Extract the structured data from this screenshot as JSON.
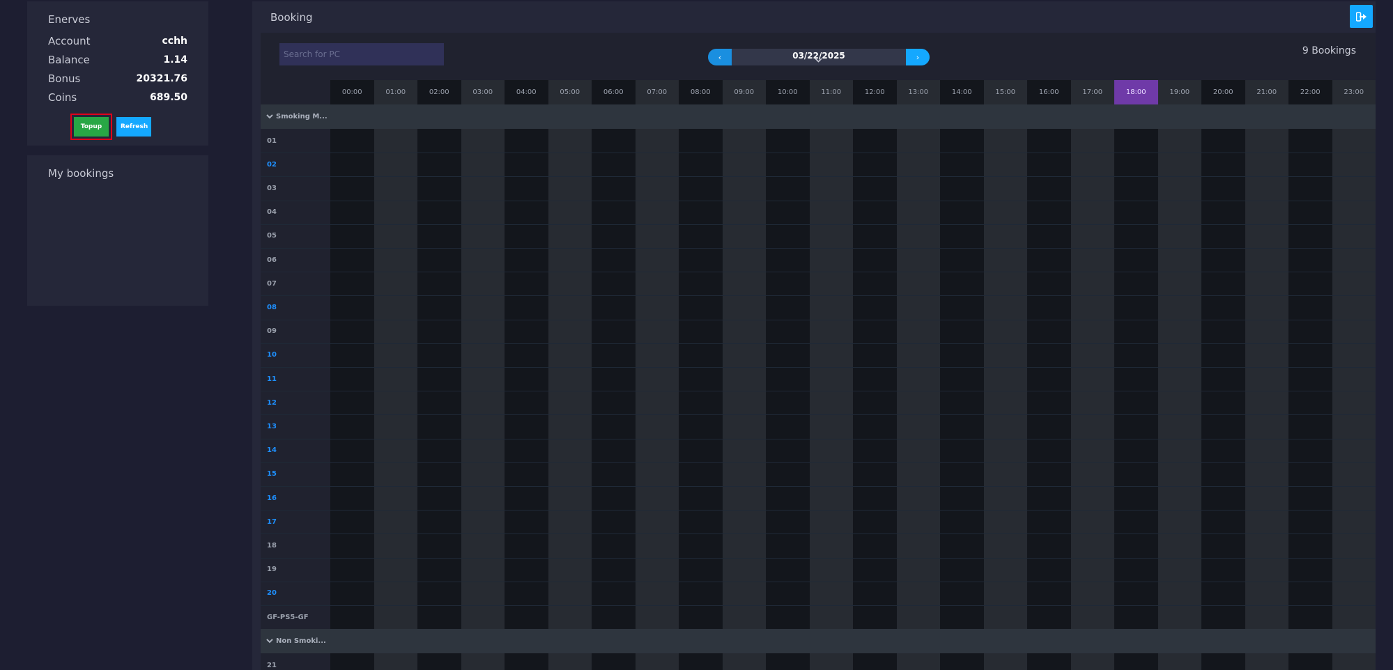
{
  "account": {
    "name": "Enerves",
    "rows": [
      {
        "label": "Account",
        "value": "cchh"
      },
      {
        "label": "Balance",
        "value": "1.14"
      },
      {
        "label": "Bonus",
        "value": "20321.76"
      },
      {
        "label": "Coins",
        "value": "689.50"
      }
    ],
    "topup_label": "Topup",
    "refresh_label": "Refresh"
  },
  "my_bookings": {
    "title": "My bookings"
  },
  "booking": {
    "title": "Booking",
    "search_placeholder": "Search for PC",
    "date": "03/22/2025",
    "prev_label": "‹",
    "next_label": "›",
    "count": "9 Bookings",
    "current_hour": "18:00",
    "hours": [
      "00:00",
      "01:00",
      "02:00",
      "03:00",
      "04:00",
      "05:00",
      "06:00",
      "07:00",
      "08:00",
      "09:00",
      "10:00",
      "11:00",
      "12:00",
      "13:00",
      "14:00",
      "15:00",
      "16:00",
      "17:00",
      "18:00",
      "19:00",
      "20:00",
      "21:00",
      "22:00",
      "23:00"
    ],
    "groups": [
      {
        "name": "Smoking M...",
        "pcs": [
          {
            "label": "01",
            "available": false
          },
          {
            "label": "02",
            "available": true
          },
          {
            "label": "03",
            "available": false
          },
          {
            "label": "04",
            "available": false
          },
          {
            "label": "05",
            "available": false
          },
          {
            "label": "06",
            "available": false
          },
          {
            "label": "07",
            "available": false
          },
          {
            "label": "08",
            "available": true
          },
          {
            "label": "09",
            "available": false
          },
          {
            "label": "10",
            "available": true
          },
          {
            "label": "11",
            "available": true
          },
          {
            "label": "12",
            "available": true
          },
          {
            "label": "13",
            "available": true
          },
          {
            "label": "14",
            "available": true
          },
          {
            "label": "15",
            "available": true
          },
          {
            "label": "16",
            "available": true
          },
          {
            "label": "17",
            "available": true
          },
          {
            "label": "18",
            "available": false
          },
          {
            "label": "19",
            "available": false
          },
          {
            "label": "20",
            "available": true
          },
          {
            "label": "GF-PS5-GF",
            "available": false
          }
        ]
      },
      {
        "name": "Non Smoki...",
        "pcs": [
          {
            "label": "21",
            "available": false
          }
        ]
      }
    ]
  },
  "colors": {
    "available": "#1e90ff",
    "current_hour": "#6f3aa8",
    "topup": "#28a745",
    "refresh": "#14a8ff",
    "highlight": "#e0001b"
  }
}
